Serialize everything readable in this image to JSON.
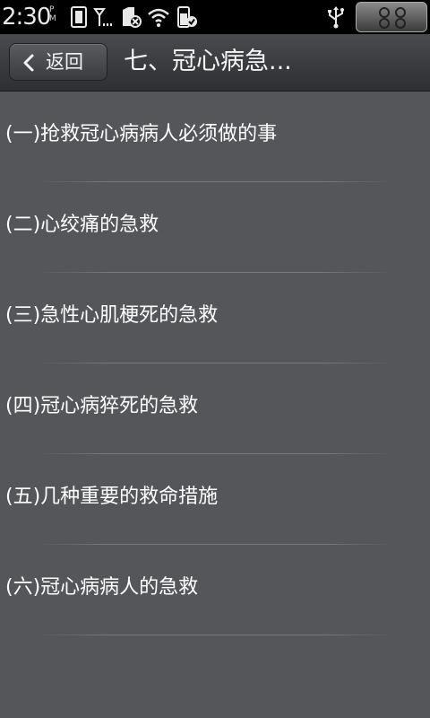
{
  "status_bar": {
    "time": "2:30",
    "ampm_top": "P",
    "ampm_bottom": "M",
    "icons": [
      "phone-memory-icon",
      "signal-icon",
      "sd-card-error-icon",
      "wifi-icon",
      "battery-icon",
      "usb-icon"
    ],
    "menu_key": "menu-key-icon"
  },
  "title_bar": {
    "back_label": "返回",
    "title": "七、冠心病急..."
  },
  "list": {
    "items": [
      {
        "label": "(一)抢救冠心病病人必须做的事"
      },
      {
        "label": "(二)心绞痛的急救"
      },
      {
        "label": "(三)急性心肌梗死的急救"
      },
      {
        "label": "(四)冠心病猝死的急救"
      },
      {
        "label": "(五)几种重要的救命措施"
      },
      {
        "label": "(六)冠心病病人的急救"
      }
    ]
  },
  "colors": {
    "background": "#555659",
    "titlebar": "#3a3b3e",
    "text": "#ffffff"
  }
}
